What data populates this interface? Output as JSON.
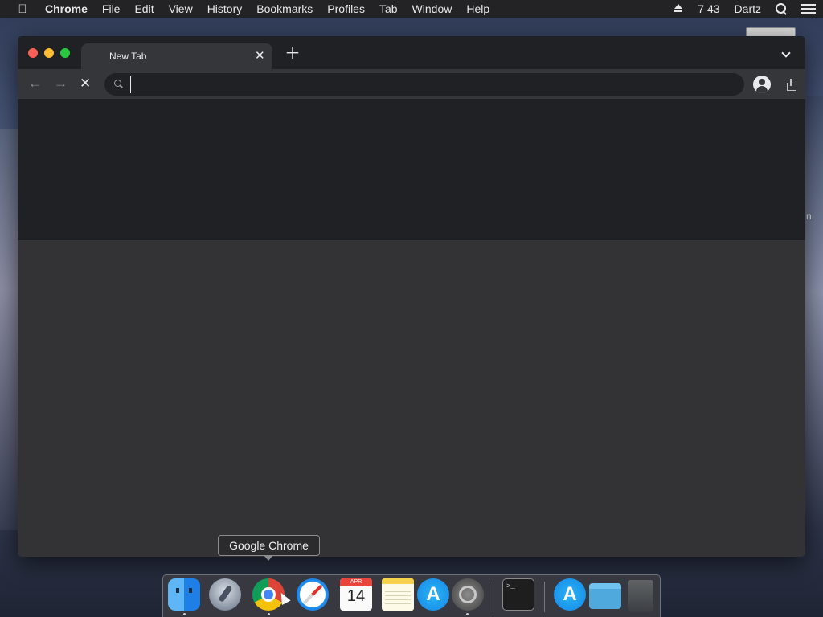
{
  "menubar": {
    "app_name": "Chrome",
    "items": [
      "File",
      "Edit",
      "View",
      "History",
      "Bookmarks",
      "Profiles",
      "Tab",
      "Window",
      "Help"
    ],
    "clock": "7 43",
    "user": "Dartz"
  },
  "browser": {
    "tab_title": "New Tab",
    "omnibox_value": ""
  },
  "desktop": {
    "partial_label": "n"
  },
  "dock": {
    "tooltip": "Google Chrome",
    "calendar_month": "APR",
    "calendar_day": "14",
    "terminal_prompt": ">_"
  }
}
